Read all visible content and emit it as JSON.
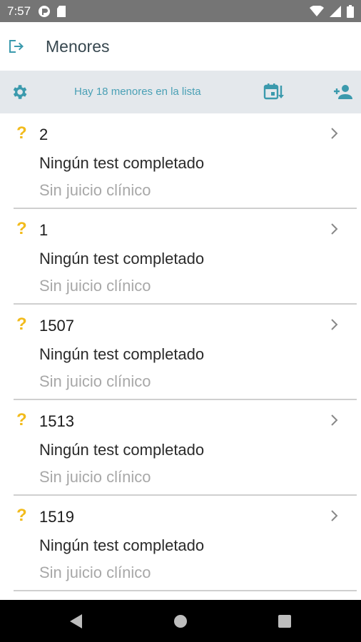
{
  "status_bar": {
    "time": "7:57"
  },
  "app_bar": {
    "title": "Menores"
  },
  "toolbar": {
    "summary": "Hay 18 menores en la lista"
  },
  "children": [
    {
      "mark": "?",
      "id": "2",
      "tests": "Ningún test completado",
      "juicio": "Sin juicio clínico"
    },
    {
      "mark": "?",
      "id": "1",
      "tests": "Ningún test completado",
      "juicio": "Sin juicio clínico"
    },
    {
      "mark": "?",
      "id": "1507",
      "tests": "Ningún test completado",
      "juicio": "Sin juicio clínico"
    },
    {
      "mark": "?",
      "id": "1513",
      "tests": "Ningún test completado",
      "juicio": "Sin juicio clínico"
    },
    {
      "mark": "?",
      "id": "1519",
      "tests": "Ningún test completado",
      "juicio": "Sin juicio clínico"
    }
  ],
  "colors": {
    "accent": "#3b9aad",
    "warning": "#f2bb1c",
    "toolbar_bg": "#e4e8ec",
    "status_bg": "#757575"
  },
  "icons": {
    "logout": "logout-icon",
    "settings": "gear-icon",
    "sort": "calendar-sort-icon",
    "add_user": "person-add-icon",
    "chevron": "chevron-right-icon"
  }
}
